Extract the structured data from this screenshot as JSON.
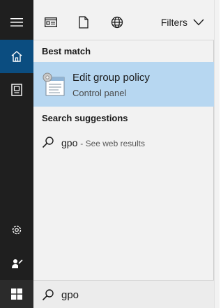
{
  "rail": {
    "icons": [
      "hamburger-menu-icon",
      "home-icon",
      "notebook-icon",
      "settings-gear-icon",
      "feedback-person-icon",
      "windows-start-icon"
    ],
    "active_item": "home-icon",
    "active_color": "#0b4d80"
  },
  "toolbar": {
    "icons": [
      "apps-filter-icon",
      "documents-filter-icon",
      "web-filter-icon"
    ],
    "filters_label": "Filters"
  },
  "best_match": {
    "heading": "Best match",
    "title": "Edit group policy",
    "subtitle": "Control panel",
    "icon": "group-policy-icon",
    "highlight_color": "#b7d7f1"
  },
  "suggestions": {
    "heading": "Search suggestions",
    "items": [
      {
        "query": "gpo",
        "hint": "- See web results",
        "icon": "search-icon"
      }
    ]
  },
  "search": {
    "value": "gpo"
  }
}
